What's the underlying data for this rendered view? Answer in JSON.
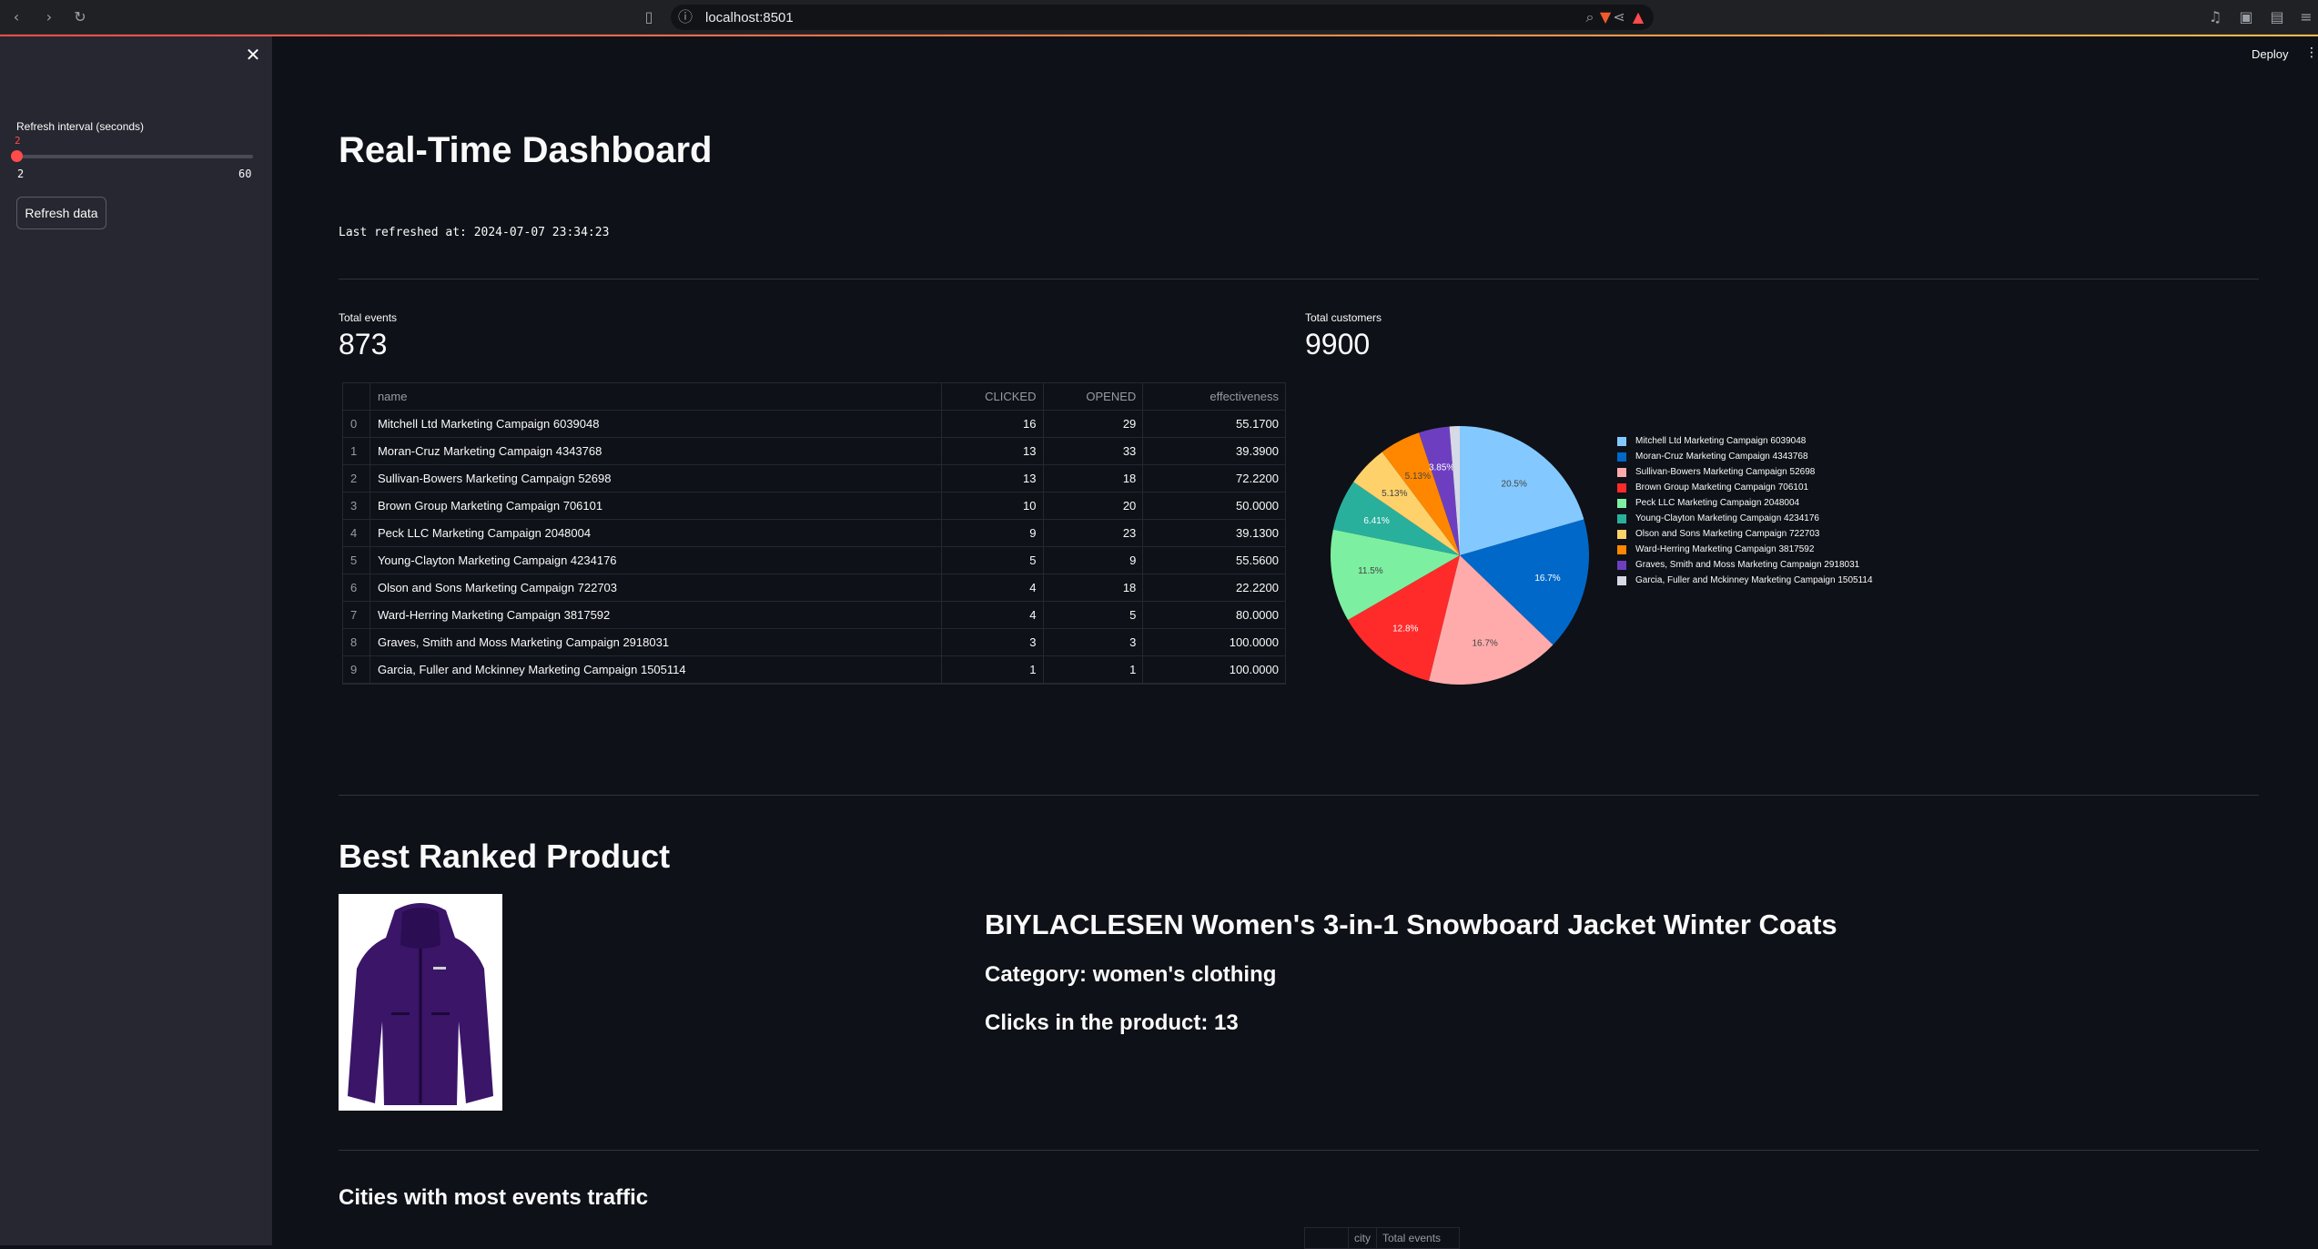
{
  "browser": {
    "url": "localhost:8501"
  },
  "sidebar": {
    "slider_label": "Refresh interval (seconds)",
    "slider_value": "2",
    "slider_min": "2",
    "slider_max": "60",
    "refresh_button": "Refresh data"
  },
  "toolbar": {
    "deploy": "Deploy"
  },
  "main": {
    "title": "Real-Time Dashboard",
    "last_refreshed": "Last refreshed at: 2024-07-07 23:34:23",
    "total_events_label": "Total events",
    "total_events_value": "873",
    "total_customers_label": "Total customers",
    "total_customers_value": "9900"
  },
  "table": {
    "headers": [
      "name",
      "CLICKED",
      "OPENED",
      "effectiveness"
    ],
    "rows": [
      {
        "idx": "0",
        "name": "Mitchell Ltd Marketing Campaign 6039048",
        "clicked": "16",
        "opened": "29",
        "eff": "55.1700"
      },
      {
        "idx": "1",
        "name": "Moran-Cruz Marketing Campaign 4343768",
        "clicked": "13",
        "opened": "33",
        "eff": "39.3900"
      },
      {
        "idx": "2",
        "name": "Sullivan-Bowers Marketing Campaign 52698",
        "clicked": "13",
        "opened": "18",
        "eff": "72.2200"
      },
      {
        "idx": "3",
        "name": "Brown Group Marketing Campaign 706101",
        "clicked": "10",
        "opened": "20",
        "eff": "50.0000"
      },
      {
        "idx": "4",
        "name": "Peck LLC Marketing Campaign 2048004",
        "clicked": "9",
        "opened": "23",
        "eff": "39.1300"
      },
      {
        "idx": "5",
        "name": "Young-Clayton Marketing Campaign 4234176",
        "clicked": "5",
        "opened": "9",
        "eff": "55.5600"
      },
      {
        "idx": "6",
        "name": "Olson and Sons Marketing Campaign 722703",
        "clicked": "4",
        "opened": "18",
        "eff": "22.2200"
      },
      {
        "idx": "7",
        "name": "Ward-Herring Marketing Campaign 3817592",
        "clicked": "4",
        "opened": "5",
        "eff": "80.0000"
      },
      {
        "idx": "8",
        "name": "Graves, Smith and Moss Marketing Campaign 2918031",
        "clicked": "3",
        "opened": "3",
        "eff": "100.0000"
      },
      {
        "idx": "9",
        "name": "Garcia, Fuller and Mckinney Marketing Campaign 1505114",
        "clicked": "1",
        "opened": "1",
        "eff": "100.0000"
      }
    ]
  },
  "chart_data": {
    "type": "pie",
    "labels": [
      "Mitchell Ltd Marketing Campaign 6039048",
      "Moran-Cruz Marketing Campaign 4343768",
      "Sullivan-Bowers Marketing Campaign 52698",
      "Brown Group Marketing Campaign 706101",
      "Peck LLC Marketing Campaign 2048004",
      "Young-Clayton Marketing Campaign 4234176",
      "Olson and Sons Marketing Campaign 722703",
      "Ward-Herring Marketing Campaign 3817592",
      "Graves, Smith and Moss Marketing Campaign 2918031",
      "Garcia, Fuller and Mckinney Marketing Campaign 1505114"
    ],
    "values": [
      16,
      13,
      13,
      10,
      9,
      5,
      4,
      4,
      3,
      1
    ],
    "pct_labels": [
      "20.5%",
      "16.7%",
      "16.7%",
      "12.8%",
      "11.5%",
      "6.41%",
      "5.13%",
      "5.13%",
      "3.85%",
      "1.28%"
    ],
    "colors": [
      "#83c9ff",
      "#0068c9",
      "#ffabab",
      "#ff2b2b",
      "#7defa1",
      "#29b09d",
      "#ffd16a",
      "#ff8700",
      "#6d3fc0",
      "#d5dae5"
    ],
    "legend": "right"
  },
  "product": {
    "section_title": "Best Ranked Product",
    "title": "BIYLACLESEN Women's 3-in-1 Snowboard Jacket Winter Coats",
    "category": "Category: women's clothing",
    "clicks": "Clicks in the product: 13"
  },
  "cities": {
    "title": "Cities with most events traffic",
    "headers": [
      "city",
      "Total events"
    ]
  }
}
